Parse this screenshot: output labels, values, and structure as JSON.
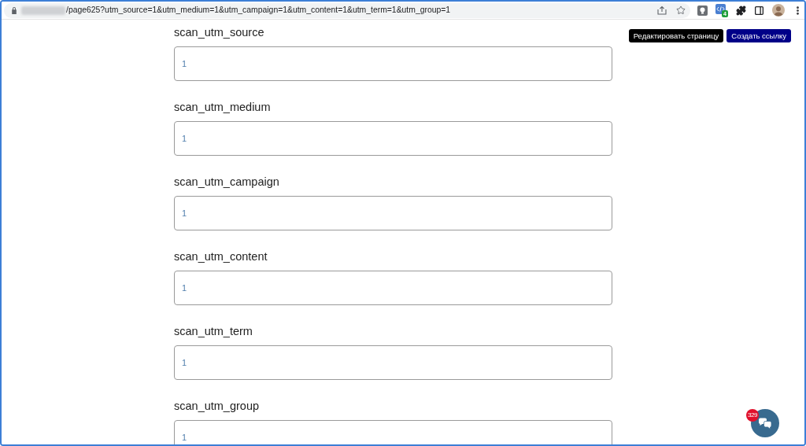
{
  "browser": {
    "url_path": "/page625?utm_source=1&utm_medium=1&utm_campaign=1&utm_content=1&utm_term=1&utm_group=1",
    "extension_badge": "4"
  },
  "fields": [
    {
      "label": "scan_utm_source",
      "value": "1"
    },
    {
      "label": "scan_utm_medium",
      "value": "1"
    },
    {
      "label": "scan_utm_campaign",
      "value": "1"
    },
    {
      "label": "scan_utm_content",
      "value": "1"
    },
    {
      "label": "scan_utm_term",
      "value": "1"
    },
    {
      "label": "scan_utm_group",
      "value": "1"
    }
  ],
  "buttons": [
    {
      "label": "Редактировать страницу",
      "kind": "edit"
    },
    {
      "label": "Создать ссылку",
      "kind": "create"
    }
  ],
  "chat": {
    "badge": "329"
  }
}
